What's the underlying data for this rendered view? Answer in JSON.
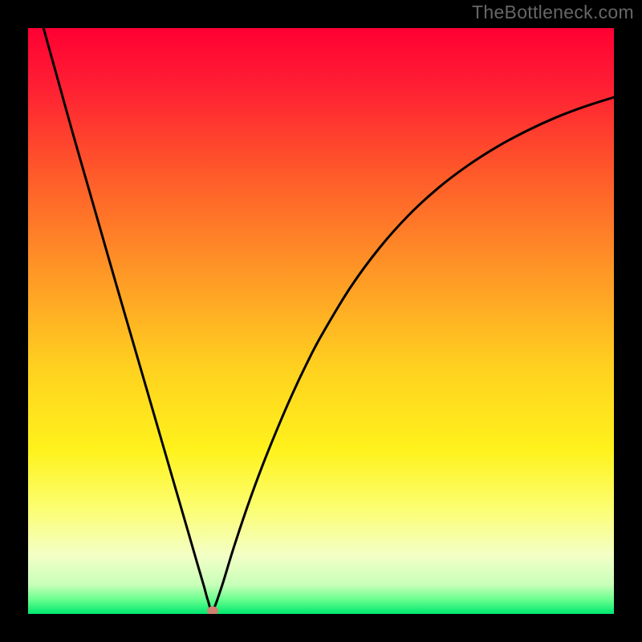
{
  "watermark": "TheBottleneck.com",
  "chart_data": {
    "type": "line",
    "title": "",
    "xlabel": "",
    "ylabel": "",
    "xrange": [
      0,
      100
    ],
    "yrange": [
      0,
      100
    ],
    "grid": false,
    "legend": false,
    "gradient_stops": [
      {
        "pos": 0.0,
        "color": "#ff0033"
      },
      {
        "pos": 0.1,
        "color": "#ff1f33"
      },
      {
        "pos": 0.25,
        "color": "#ff5a2a"
      },
      {
        "pos": 0.42,
        "color": "#ff9826"
      },
      {
        "pos": 0.58,
        "color": "#ffd11f"
      },
      {
        "pos": 0.72,
        "color": "#fff21c"
      },
      {
        "pos": 0.82,
        "color": "#fcfe71"
      },
      {
        "pos": 0.9,
        "color": "#f3ffc6"
      },
      {
        "pos": 0.95,
        "color": "#c8ffb9"
      },
      {
        "pos": 0.975,
        "color": "#6bff90"
      },
      {
        "pos": 1.0,
        "color": "#00e86f"
      }
    ],
    "series": [
      {
        "name": "bottleneck-curve",
        "color": "#000000",
        "x": [
          0.0,
          2.5,
          5.0,
          7.5,
          10.0,
          12.5,
          15.0,
          17.5,
          20.0,
          22.5,
          25.0,
          27.5,
          29.0,
          30.0,
          30.7,
          31.5,
          33.0,
          35.0,
          37.5,
          40.0,
          42.5,
          45.0,
          47.5,
          50.0,
          55.0,
          60.0,
          65.0,
          70.0,
          75.0,
          80.0,
          85.0,
          90.0,
          95.0,
          100.0
        ],
        "values": [
          110.0,
          100.5,
          91.5,
          82.5,
          73.8,
          65.1,
          56.4,
          47.8,
          39.2,
          30.6,
          22.0,
          13.4,
          8.2,
          4.8,
          2.3,
          0.6,
          4.5,
          11.0,
          18.5,
          25.3,
          31.5,
          37.3,
          42.6,
          47.4,
          55.7,
          62.5,
          68.1,
          72.7,
          76.5,
          79.7,
          82.4,
          84.7,
          86.6,
          88.2
        ]
      }
    ],
    "markers": [
      {
        "name": "minimum-point",
        "x": 31.5,
        "y": 0.6,
        "color": "#d08070"
      }
    ]
  }
}
